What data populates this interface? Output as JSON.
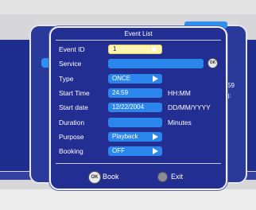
{
  "background": {
    "right_partial_number": "59",
    "right_partial_colon": "):"
  },
  "dialog": {
    "title": "Event List",
    "rows": {
      "event_id": {
        "label": "Event ID",
        "value": "1"
      },
      "service": {
        "label": "Service",
        "value": "",
        "ok_label": "OK"
      },
      "type": {
        "label": "Type",
        "value": "ONCE"
      },
      "start_time": {
        "label": "Start Time",
        "value": "24:59",
        "unit": "HH:MM"
      },
      "start_date": {
        "label": "Start date",
        "value": "12/22/2004",
        "unit": "DD/MM/YYYY"
      },
      "duration": {
        "label": "Duration",
        "value": "",
        "unit": "Minutes"
      },
      "purpose": {
        "label": "Purpose",
        "value": "Playback"
      },
      "booking": {
        "label": "Booking",
        "value": "OFF"
      }
    },
    "footer": {
      "ok_icon": "OK",
      "book_label": "Book",
      "exit_label": "Exit"
    }
  },
  "colors": {
    "panel": "#232e93",
    "field": "#2a86ec",
    "selected_field": "#fdf5b0",
    "text": "#ffffff"
  }
}
